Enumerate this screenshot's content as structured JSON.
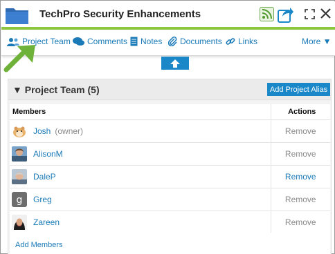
{
  "header": {
    "title": "TechPro Security Enhancements",
    "icons": [
      "folder-icon",
      "rss-icon",
      "share-icon",
      "expand-icon",
      "close-icon"
    ]
  },
  "tabs": [
    {
      "label": "Project Team",
      "icon": "people-icon"
    },
    {
      "label": "Comments",
      "icon": "speech-bubble-icon"
    },
    {
      "label": "Notes",
      "icon": "note-icon"
    },
    {
      "label": "Documents",
      "icon": "paperclip-icon"
    },
    {
      "label": "Links",
      "icon": "link-icon"
    }
  ],
  "more_label": "More ▼",
  "panel": {
    "title": "▼ Project Team (5)",
    "add_alias_label": "Add Project Alias",
    "columns": {
      "members": "Members",
      "actions": "Actions"
    },
    "members": [
      {
        "name": "Josh",
        "role": "(owner)",
        "action": "Remove",
        "avatar": "hamster-avatar"
      },
      {
        "name": "AlisonM",
        "role": "",
        "action": "Remove",
        "avatar": "photo-avatar"
      },
      {
        "name": "DaleP",
        "role": "",
        "action": "Remove",
        "avatar": "photo-avatar"
      },
      {
        "name": "Greg",
        "role": "",
        "action": "Remove",
        "avatar": "letter-g-avatar"
      },
      {
        "name": "Zareen",
        "role": "",
        "action": "Remove",
        "avatar": "photo-avatar"
      }
    ],
    "add_members_label": "Add Members"
  },
  "colors": {
    "accent": "#1a87c9",
    "link": "#1a7ab8",
    "green_bar": "#8cc63f",
    "annotation_arrow": "#6fb23a"
  }
}
